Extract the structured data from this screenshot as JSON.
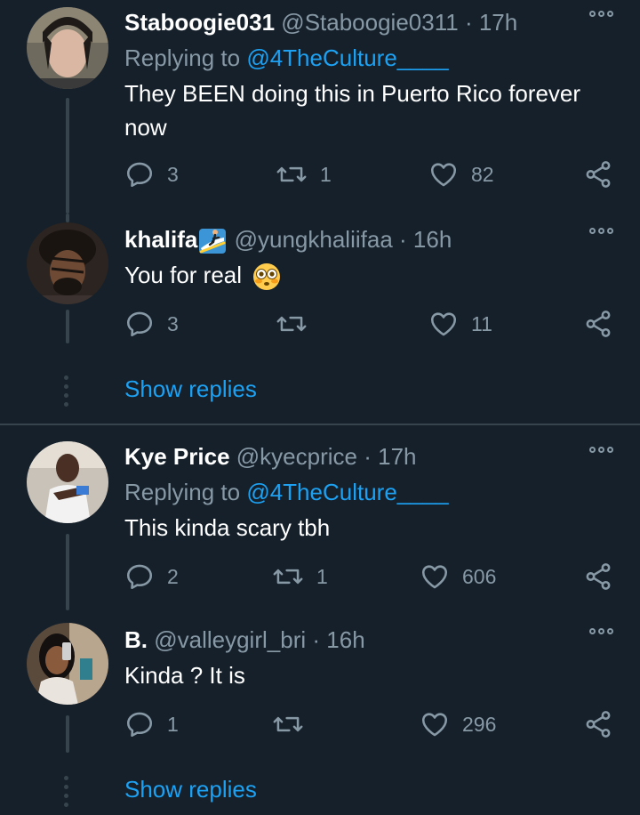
{
  "tweets": [
    {
      "name": "Staboogie031",
      "handle": "@Staboogie0311",
      "time": "17h",
      "replying_label": "Replying to",
      "replying_to": "@4TheCulture____",
      "text": "They BEEN doing this in Puerto Rico forever now",
      "replies": "3",
      "retweets": "1",
      "likes": "82"
    },
    {
      "name": "khalifa",
      "handle": "@yungkhaliifaa",
      "time": "16h",
      "text": "You for real",
      "replies": "3",
      "retweets": "",
      "likes": "11"
    },
    {
      "name": "Kye Price",
      "handle": "@kyecprice",
      "time": "17h",
      "replying_label": "Replying to",
      "replying_to": "@4TheCulture____",
      "text": "This kinda scary tbh",
      "replies": "2",
      "retweets": "1",
      "likes": "606"
    },
    {
      "name": "B.",
      "handle": "@valleygirl_bri",
      "time": "16h",
      "text": "Kinda ? It is",
      "replies": "1",
      "retweets": "",
      "likes": "296"
    }
  ],
  "show_replies_1": "Show replies",
  "show_replies_2": "Show replies",
  "separator": "·",
  "colors": {
    "background": "#15202b",
    "secondary_text": "#8899a6",
    "accent": "#1da1f2",
    "line": "#38444d"
  },
  "icons": [
    "reply-icon",
    "retweet-icon",
    "like-icon",
    "share-icon",
    "more-icon",
    "surfer-emoji",
    "flushed-emoji"
  ]
}
